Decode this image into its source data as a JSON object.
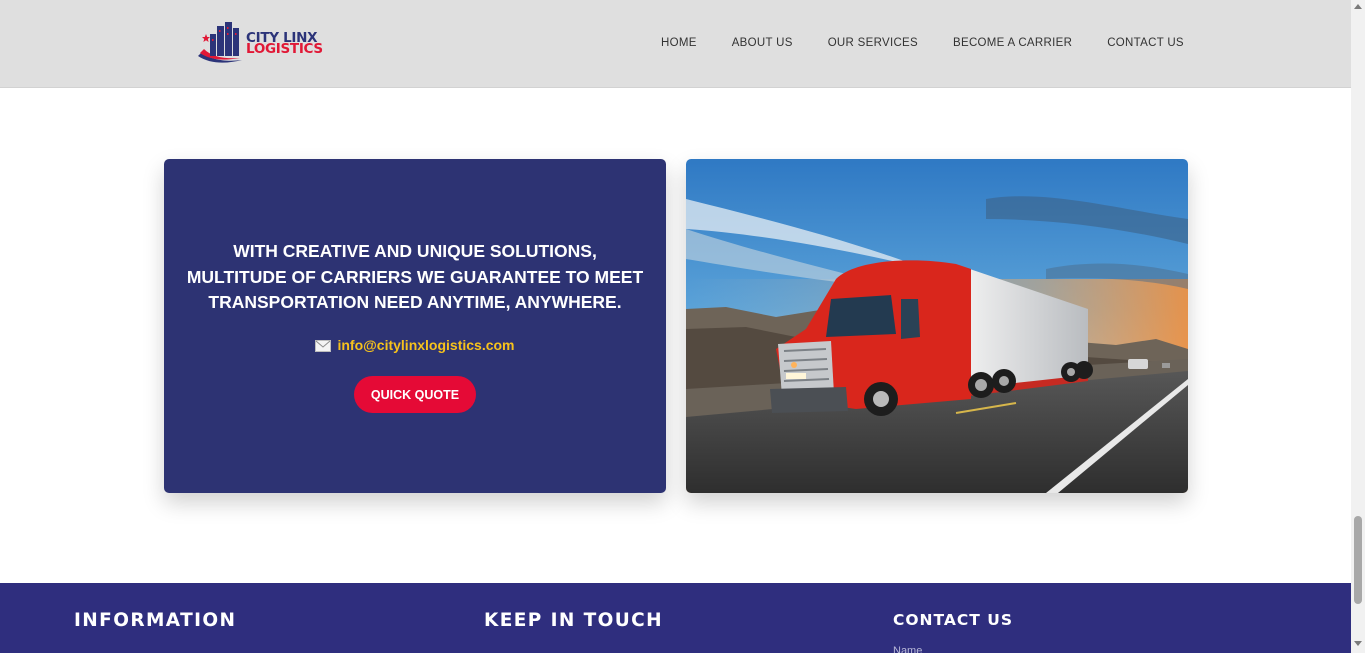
{
  "brand": {
    "line1": "CITY LINX",
    "line2": "LOGISTICS"
  },
  "nav": {
    "items": [
      "HOME",
      "ABOUT US",
      "OUR SERVICES",
      "BECOME A CARRIER",
      "CONTACT US"
    ]
  },
  "cta": {
    "headline_lines": [
      "WITH CREATIVE AND UNIQUE SOLUTIONS,",
      "MULTITUDE OF CARRIERS WE GUARANTEE TO MEET",
      "TRANSPORTATION NEED ANYTIME, ANYWHERE."
    ],
    "email": "info@citylinxlogistics.com",
    "email_icon": "mail-icon",
    "button_label": "QUICK QUOTE"
  },
  "footer": {
    "information_heading": "INFORMATION",
    "keep_in_touch_heading": "KEEP IN TOUCH",
    "contact_heading": "CONTACT US",
    "name_label": "Name"
  },
  "colors": {
    "header_bg": "#dfdfdf",
    "card_bg": "#2d3373",
    "email": "#f6c21c",
    "button": "#e50a36",
    "footer_bg": "#2f2e7e",
    "brand_blue": "#2c3479",
    "brand_red": "#e11836"
  }
}
